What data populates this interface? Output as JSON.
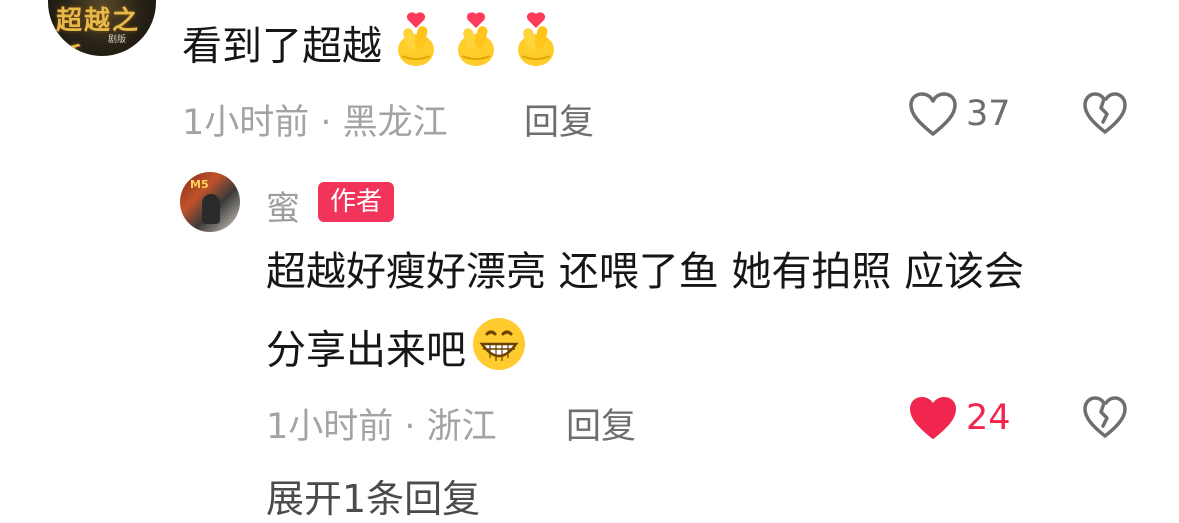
{
  "top_comment": {
    "avatar_text": "超越之跃",
    "text": "看到了超越",
    "emojis": [
      "finger-heart-icon",
      "finger-heart-icon",
      "finger-heart-icon"
    ],
    "meta": "1小时前 · 黑龙江",
    "reply_label": "回复",
    "like_count": "37"
  },
  "reply": {
    "author": "蜜",
    "badge": "作者",
    "text_line1": "超越好瘦好漂亮 还喂了鱼  她有拍照 应该会",
    "text_line2": "分享出来吧",
    "emoji": "grinning-face-icon",
    "meta": "1小时前 · 浙江",
    "reply_label": "回复",
    "like_count": "24",
    "liked": true
  },
  "expand_replies": "展开1条回复",
  "colors": {
    "liked": "#f0264f",
    "badge": "#f2345a",
    "meta": "#a3a3a3"
  }
}
